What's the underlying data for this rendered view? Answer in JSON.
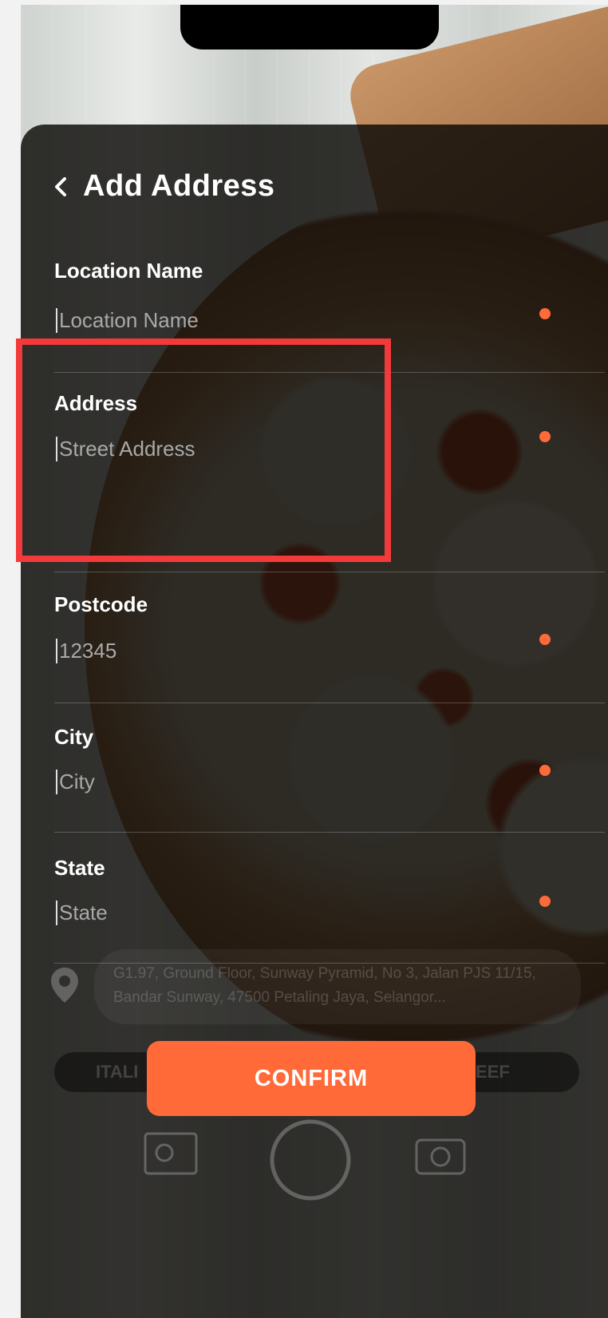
{
  "header": {
    "title": "Add Address"
  },
  "fields": {
    "location_name": {
      "label": "Location Name",
      "placeholder": "Location Name"
    },
    "address": {
      "label": "Address",
      "placeholder": "Street Address"
    },
    "postcode": {
      "label": "Postcode",
      "placeholder": "12345"
    },
    "city": {
      "label": "City",
      "placeholder": "City"
    },
    "state": {
      "label": "State",
      "placeholder": "State"
    }
  },
  "confirm_label": "CONFIRM",
  "background": {
    "address_text": "G1.97, Ground Floor, Sunway Pyramid, No 3, Jalan PJS 11/15, Bandar Sunway, 47500 Petaling Jaya, Selangor...",
    "chips": [
      "ITALI",
      "EEF"
    ]
  },
  "colors": {
    "accent": "#ff6a38",
    "highlight": "#f23a3a",
    "panel": "#0a0806"
  },
  "icons": [
    "chevron-left-icon",
    "location-pin-icon",
    "menu-card-icon",
    "shutter-icon",
    "camera-switch-icon"
  ]
}
